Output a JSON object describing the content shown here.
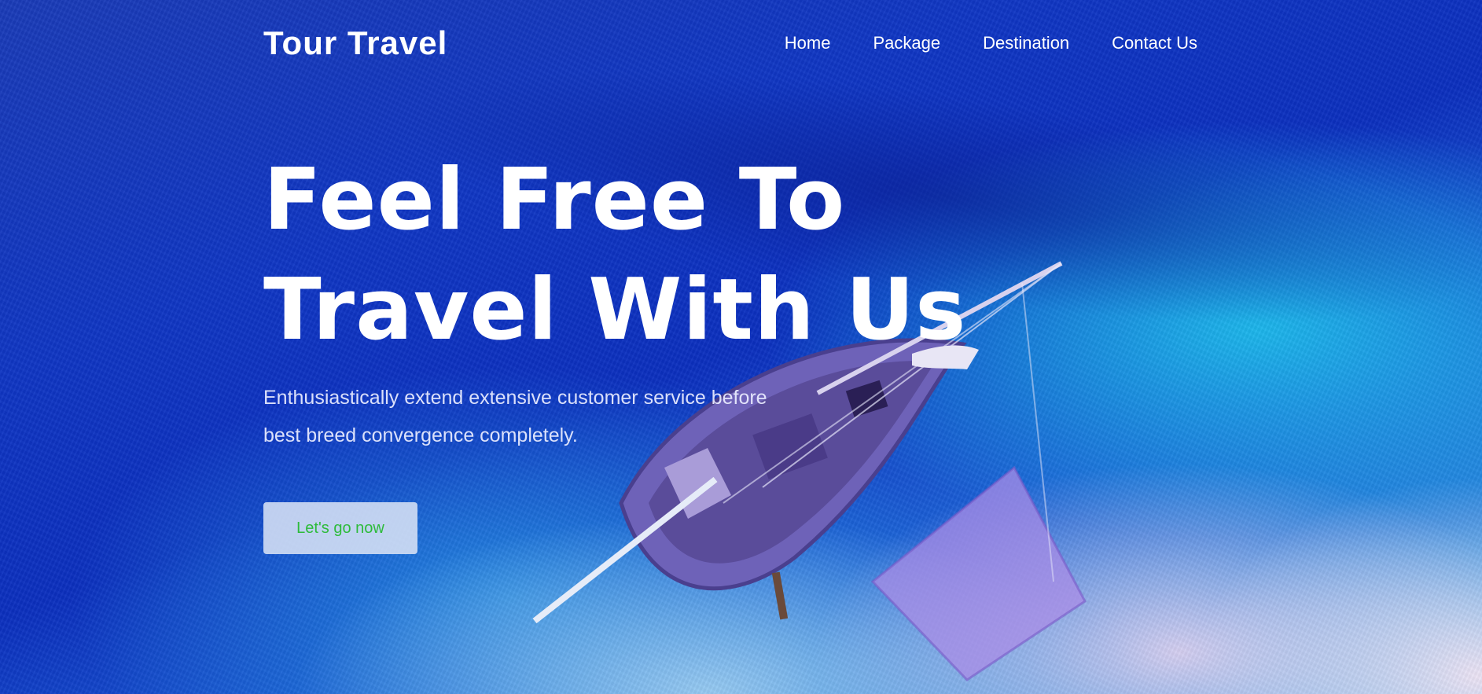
{
  "header": {
    "logo": "Tour Travel",
    "nav": [
      {
        "label": "Home"
      },
      {
        "label": "Package"
      },
      {
        "label": "Destination"
      },
      {
        "label": "Contact Us"
      }
    ]
  },
  "hero": {
    "headline_line1": "Feel Free To",
    "headline_line2": "Travel With Us",
    "subtitle_line1": "Enthusiastically extend extensive customer service before",
    "subtitle_line2": "best breed convergence completely.",
    "cta_label": "Let's go now",
    "background_image": "aerial-boat-on-beach-photo"
  },
  "colors": {
    "primary_blue": "#0f36c4",
    "cta_text": "#2dbb3a",
    "cta_background": "#d7e1f5",
    "text": "#ffffff"
  }
}
